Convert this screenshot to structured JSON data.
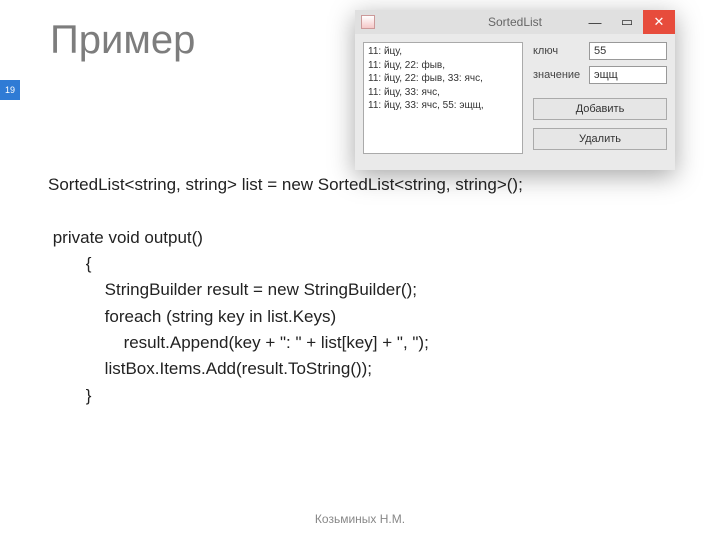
{
  "slide": {
    "title": "Пример",
    "number": "19",
    "footer": "Козьминых Н.М."
  },
  "code": {
    "line1": "SortedList<string, string> list = new SortedList<string, string>();",
    "blank1": "",
    "line2": " private void output()",
    "line3": "        {",
    "line4": "            StringBuilder result = new StringBuilder();",
    "line5": "            foreach (string key in list.Keys)",
    "line6": "                result.Append(key + \": \" + list[key] + \", \");",
    "line7": "            listBox.Items.Add(result.ToString());",
    "line8": "        }"
  },
  "window": {
    "title": "SortedList",
    "min_glyph": "—",
    "max_glyph": "▭",
    "close_glyph": "✕",
    "listbox_text": "11: йцу,\n11: йцу, 22: фыв,\n11: йцу, 22: фыв, 33: ячс,\n11: йцу, 33: ячс,\n11: йцу, 33: ячс, 55: эщщ,",
    "labels": {
      "key": "ключ",
      "value": "значение"
    },
    "fields": {
      "key": "55",
      "value": "эщщ"
    },
    "buttons": {
      "add": "Добавить",
      "delete": "Удалить"
    }
  }
}
